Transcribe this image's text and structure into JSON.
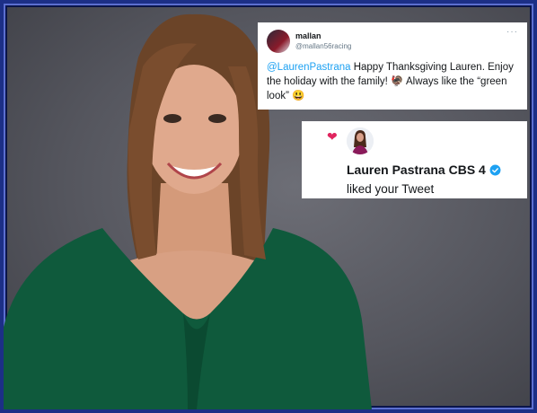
{
  "tweet": {
    "display_name": "mallan",
    "handle": "@mallan56racing",
    "more_icon": "more-options-icon",
    "mention": "@LaurenPastrana",
    "text_line1": " Happy Thanksgiving Lauren.  Enjoy",
    "text_line2_a": "the holiday with the family! ",
    "text_line2_b": " Always like the “green",
    "text_line3": "look” ",
    "emoji_turkey": "🦃",
    "emoji_smile": "😃"
  },
  "notification": {
    "icon": "heart-icon",
    "name": "Lauren Pastrana CBS 4",
    "verified_icon": "verified-badge-icon",
    "action": "liked your Tweet"
  },
  "colors": {
    "frame": "#1c2f86",
    "background": "#5a5b63",
    "dress": "#0f5a3c",
    "link": "#1da1f2",
    "heart": "#e0245e"
  }
}
